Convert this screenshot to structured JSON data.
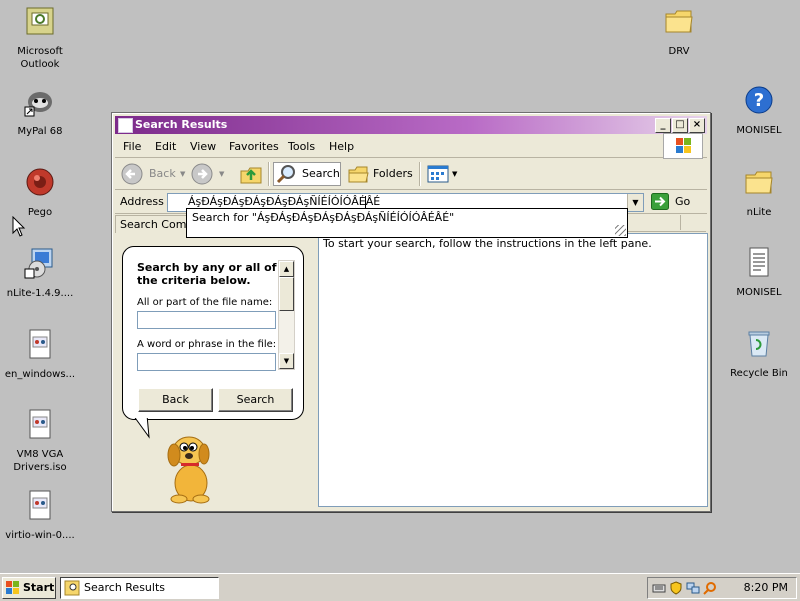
{
  "desktop": {
    "icons_left": [
      {
        "label": "Microsoft Outlook",
        "icon": "outlook-icon"
      },
      {
        "label": "MyPal 68",
        "icon": "mypal-icon"
      },
      {
        "label": "Pego",
        "icon": "pego-icon"
      },
      {
        "label": "nLite-1.4.9....",
        "icon": "nlite-setup-icon"
      },
      {
        "label": "en_windows...",
        "icon": "iso-file-icon"
      },
      {
        "label": "VM8 VGA Drivers.iso",
        "icon": "iso-file-icon"
      },
      {
        "label": "virtio-win-0....",
        "icon": "iso-file-icon"
      }
    ],
    "icons_right": [
      {
        "label": "DRV",
        "icon": "folder-icon"
      },
      {
        "label": "MONISEL",
        "icon": "help-icon"
      },
      {
        "label": "nLite",
        "icon": "folder-icon"
      },
      {
        "label": "MONISEL",
        "icon": "text-file-icon"
      },
      {
        "label": "Recycle Bin",
        "icon": "recycle-bin-icon"
      }
    ]
  },
  "window": {
    "title": "Search Results",
    "menu": [
      "File",
      "Edit",
      "View",
      "Favorites",
      "Tools",
      "Help"
    ],
    "toolbar": {
      "back_label": "Back",
      "search_label": "Search",
      "folders_label": "Folders"
    },
    "address": {
      "label": "Address",
      "value": "ÁşĐÁşĐÁşĐÁşĐÁşĐÁşÑÍÉÍÓÍÓÂÉÂÉ",
      "go_label": "Go",
      "autocomplete": "Search for \"ÁşĐÁşĐÁşĐÁşĐÁşĐÁşÑÍÉÍÓÍÓÂÉÂÉ\""
    },
    "left_pane": {
      "tab_label": "Search Compa",
      "heading": "Search by any or all of the criteria below.",
      "filename_label": "All or part of the file name:",
      "phrase_label": "A word or phrase in the file:",
      "back_button": "Back",
      "search_button": "Search"
    },
    "right_pane": {
      "hint": "To start your search, follow the instructions in the left pane."
    }
  },
  "taskbar": {
    "start_label": "Start",
    "task_label": "Search Results",
    "clock": "8:20 PM"
  },
  "colors": {
    "desktop_bg": "#c0c0c0",
    "titlebar_start": "#7c2a8a",
    "titlebar_end": "#e7d3ea"
  }
}
